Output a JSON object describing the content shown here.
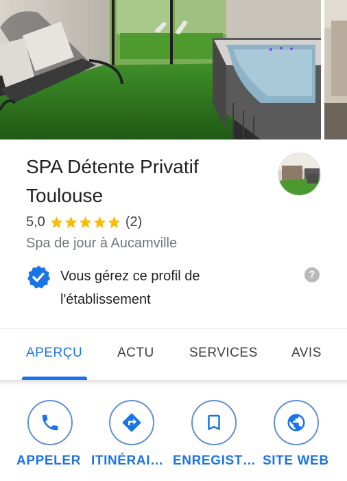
{
  "photos": {
    "main_photo_icon": "spa-interior-photo",
    "next_photo_icon": "spa-photo-thumbnail"
  },
  "header": {
    "title": "SPA Détente Privatif Toulouse",
    "rating": "5,0",
    "stars": 5,
    "review_count": "(2)",
    "category": "Spa de jour à Aucamville",
    "avatar_icon": "business-photo-avatar"
  },
  "owner": {
    "text": "Vous gérez ce profil de l'établissement",
    "badge_icon": "verified-badge-icon",
    "help_icon": "help-icon",
    "help_glyph": "?"
  },
  "tabs": [
    {
      "label": "APERÇU",
      "active": true
    },
    {
      "label": "ACTU",
      "active": false
    },
    {
      "label": "SERVICES",
      "active": false
    },
    {
      "label": "AVIS",
      "active": false
    }
  ],
  "actions": [
    {
      "label": "APPELER",
      "icon": "phone-icon"
    },
    {
      "label": "ITINÉRAI…",
      "icon": "directions-icon"
    },
    {
      "label": "ENREGIST…",
      "icon": "bookmark-icon"
    },
    {
      "label": "SITE WEB",
      "icon": "globe-icon"
    }
  ],
  "colors": {
    "accent": "#1a73e8",
    "star": "#fbbc04",
    "text_primary": "#202124",
    "text_secondary": "#70757a"
  }
}
